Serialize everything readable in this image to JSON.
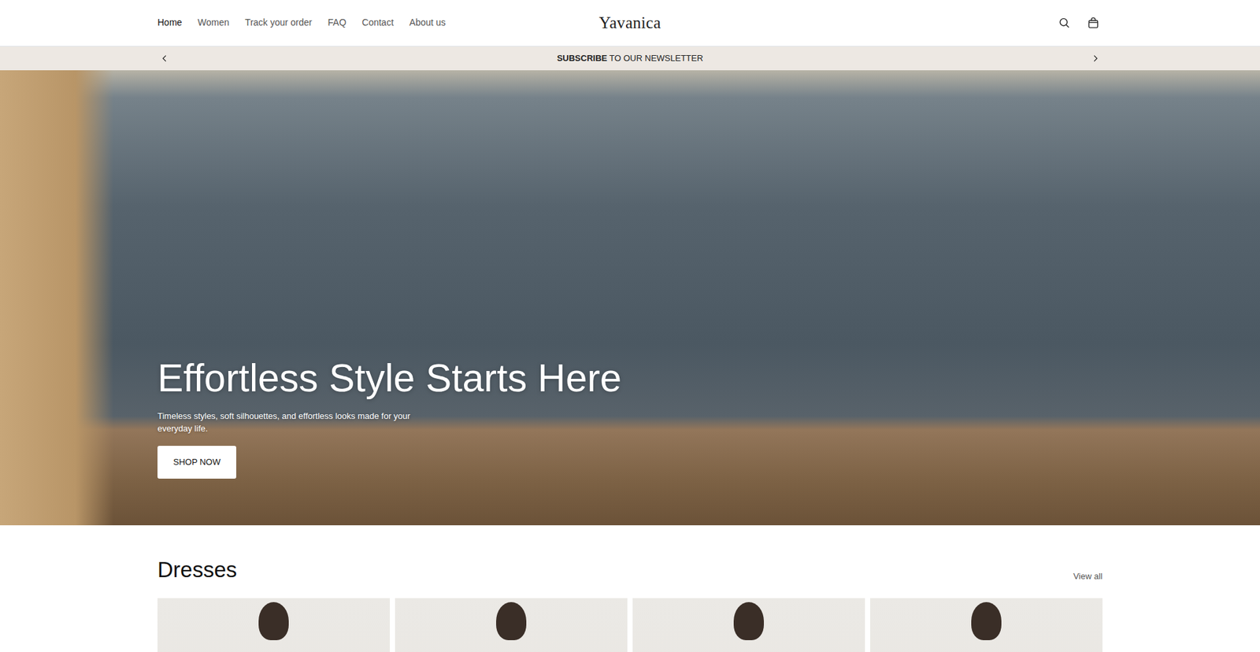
{
  "nav": [
    {
      "label": "Home",
      "selected": true
    },
    {
      "label": "Women",
      "selected": false
    },
    {
      "label": "Track your order",
      "selected": false
    },
    {
      "label": "FAQ",
      "selected": false
    },
    {
      "label": "Contact",
      "selected": false
    },
    {
      "label": "About us",
      "selected": false
    }
  ],
  "logo": "Yavanica",
  "announcement": {
    "bold": "SUBSCRIBE",
    "rest": " TO OUR NEWSLETTER"
  },
  "hero": {
    "title": "Effortless Style Starts Here",
    "subtitle": "Timeless styles, soft silhouettes, and effortless looks made for your everyday life.",
    "button": "SHOP NOW"
  },
  "dresses": {
    "title": "Dresses",
    "link": "View all",
    "cards": [
      {
        "kind": "photo"
      },
      {
        "kind": "photo"
      },
      {
        "kind": "photo"
      },
      {
        "kind": "photo"
      }
    ]
  }
}
